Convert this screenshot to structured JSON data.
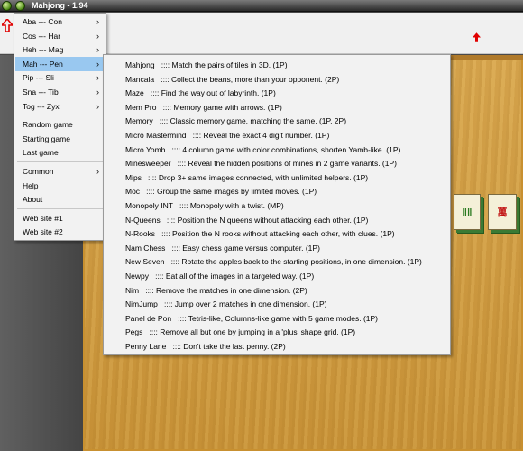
{
  "window": {
    "title": "Mahjong - 1.94"
  },
  "menu_main": {
    "groups": [
      {
        "label": "Aba --- Con",
        "submenu": true
      },
      {
        "label": "Cos --- Har",
        "submenu": true
      },
      {
        "label": "Heh --- Mag",
        "submenu": true
      },
      {
        "label": "Mah --- Pen",
        "submenu": true,
        "selected": true
      },
      {
        "label": "Pip --- Sli",
        "submenu": true
      },
      {
        "label": "Sna --- Tib",
        "submenu": true
      },
      {
        "label": "Tog --- Zyx",
        "submenu": true
      }
    ],
    "actions": [
      "Random game",
      "Starting game",
      "Last game"
    ],
    "misc": [
      {
        "label": "Common",
        "submenu": true
      },
      {
        "label": "Help",
        "submenu": false
      },
      {
        "label": "About",
        "submenu": false
      }
    ],
    "links": [
      "Web site #1",
      "Web site #2"
    ],
    "arrow_glyph": "›"
  },
  "menu_games": {
    "items": [
      {
        "name": "Mahjong",
        "desc": ":::: Match the pairs of tiles in 3D. (1P)"
      },
      {
        "name": "Mancala",
        "desc": ":::: Collect the beans, more than your opponent. (2P)"
      },
      {
        "name": "Maze",
        "desc": ":::: Find the way out of labyrinth. (1P)"
      },
      {
        "name": "Mem Pro",
        "desc": ":::: Memory game with arrows. (1P)"
      },
      {
        "name": "Memory",
        "desc": ":::: Classic memory game, matching the same. (1P, 2P)"
      },
      {
        "name": "Micro Mastermind",
        "desc": ":::: Reveal the exact 4 digit number. (1P)"
      },
      {
        "name": "Micro Yomb",
        "desc": ":::: 4 column game with color combinations, shorten Yamb-like. (1P)"
      },
      {
        "name": "Minesweeper",
        "desc": ":::: Reveal the hidden positions of mines in 2 game variants. (1P)"
      },
      {
        "name": "Mips",
        "desc": ":::: Drop 3+ same images connected, with unlimited helpers. (1P)"
      },
      {
        "name": "Moc",
        "desc": ":::: Group the same images by limited moves. (1P)"
      },
      {
        "name": "Monopoly INT",
        "desc": ":::: Monopoly with a twist. (MP)"
      },
      {
        "name": "N-Queens",
        "desc": ":::: Position the N queens without attacking each other. (1P)"
      },
      {
        "name": "N-Rooks",
        "desc": ":::: Position the N rooks without attacking each other, with clues. (1P)"
      },
      {
        "name": "Nam Chess",
        "desc": ":::: Easy chess game versus computer. (1P)"
      },
      {
        "name": "New Seven",
        "desc": ":::: Rotate the apples back to the starting positions, in one dimension. (1P)"
      },
      {
        "name": "Newpy",
        "desc": ":::: Eat all of the images in a targeted way. (1P)"
      },
      {
        "name": "Nim",
        "desc": ":::: Remove the matches in one dimension. (2P)"
      },
      {
        "name": "NimJump",
        "desc": ":::: Jump over 2 matches in one dimension. (1P)"
      },
      {
        "name": "Panel de Pon",
        "desc": ":::: Tetris-like, Columns-like game with 5 game modes. (1P)"
      },
      {
        "name": "Pegs",
        "desc": ":::: Remove all but one by jumping in a 'plus' shape grid. (1P)"
      },
      {
        "name": "Penny Lane",
        "desc": ":::: Don't take the last penny. (2P)"
      }
    ]
  },
  "colors": {
    "selection": "#99c8f0",
    "board": "#d6a24a",
    "tile_face": "#f4f0d8",
    "tile_side": "#3a7a34",
    "arrow": "#e00000"
  },
  "icons": {
    "title_buttons": "green-orb-icon",
    "toolbar_arrows": "red-up-arrow-icon"
  }
}
